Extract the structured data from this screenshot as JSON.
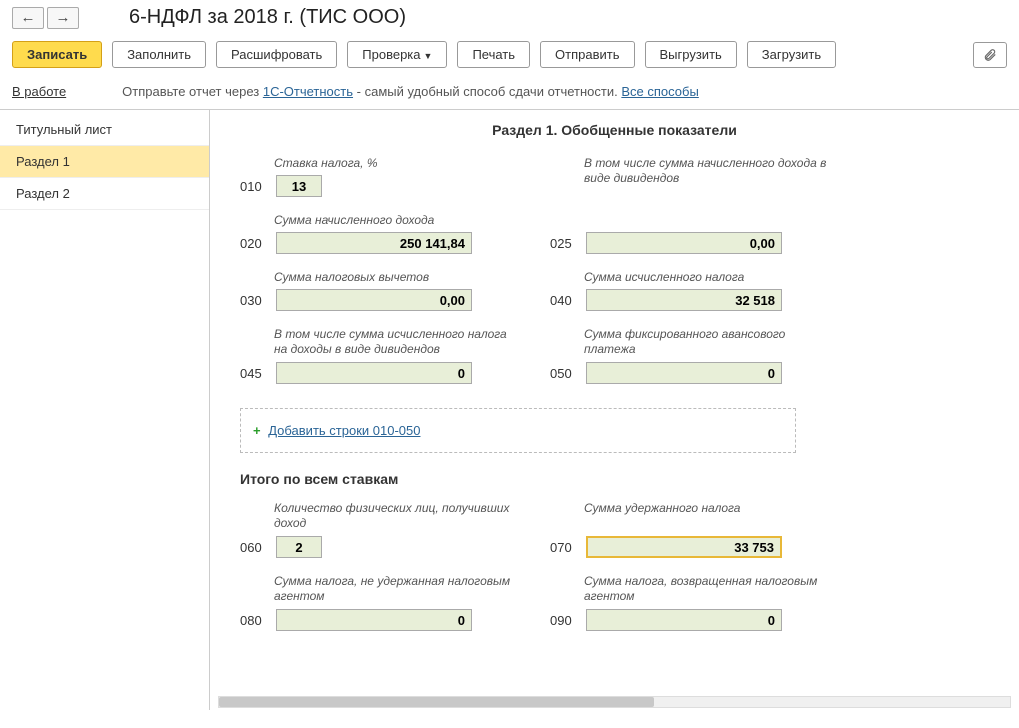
{
  "header": {
    "title": "6-НДФЛ за 2018 г. (ТИС ООО)"
  },
  "toolbar": {
    "save": "Записать",
    "fill": "Заполнить",
    "decode": "Расшифровать",
    "check": "Проверка",
    "print": "Печать",
    "send": "Отправить",
    "export": "Выгрузить",
    "import": "Загрузить"
  },
  "info": {
    "status": "В работе",
    "text1": "Отправьте отчет через ",
    "link1": "1С-Отчетность",
    "text2": " - самый удобный способ сдачи отчетности. ",
    "link2": "Все способы"
  },
  "sidebar": {
    "items": [
      "Титульный лист",
      "Раздел 1",
      "Раздел 2"
    ]
  },
  "section": {
    "title": "Раздел 1. Обобщенные показатели",
    "labels": {
      "rate": "Ставка налога, %",
      "income": "Сумма начисленного дохода",
      "dividends": "В том числе сумма начисленного дохода в виде дивидендов",
      "deductions": "Сумма налоговых вычетов",
      "calculated_tax": "Сумма исчисленного налога",
      "calc_tax_div": "В том числе сумма исчисленного налога на доходы в виде дивидендов",
      "fixed_advance": "Сумма фиксированного авансового платежа"
    },
    "fields": {
      "010": "13",
      "020": "250 141,84",
      "025": "0,00",
      "030": "0,00",
      "040": "32 518",
      "045": "0",
      "050": "0"
    },
    "add_link": "Добавить строки 010-050",
    "totals_title": "Итого по всем ставкам",
    "totals_labels": {
      "persons": "Количество физических лиц, получивших доход",
      "withheld": "Сумма удержанного налога",
      "not_withheld": "Сумма налога, не удержанная налоговым агентом",
      "returned": "Сумма налога, возвращенная налоговым агентом"
    },
    "totals_fields": {
      "060": "2",
      "070": "33 753",
      "080": "0",
      "090": "0"
    }
  }
}
